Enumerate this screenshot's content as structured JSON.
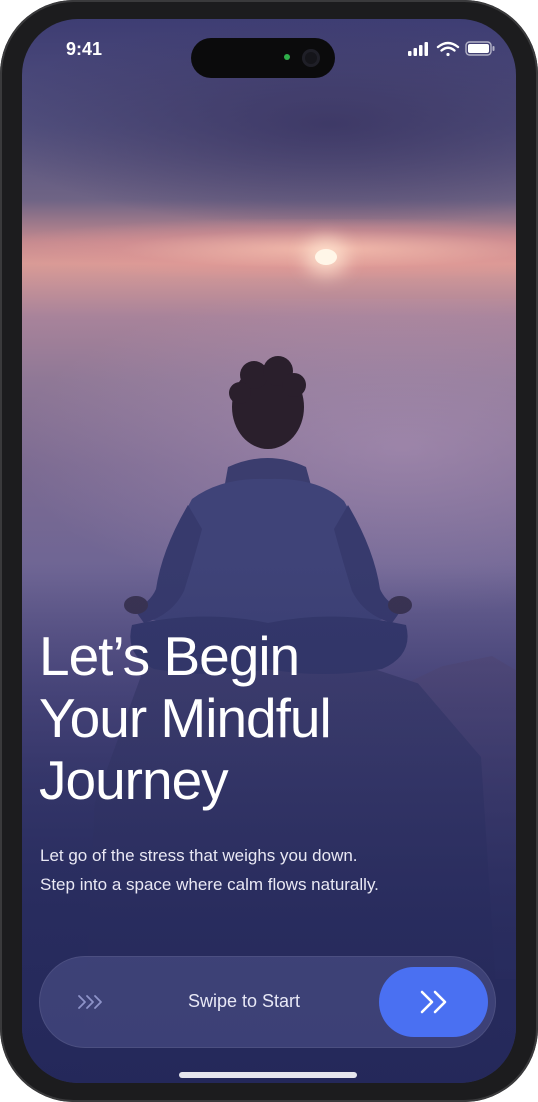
{
  "status_bar": {
    "time": "9:41"
  },
  "hero": {
    "headline_lines": [
      "Let’s Begin",
      "Your Mindful",
      "Journey"
    ],
    "subtitle_lines": [
      "Let go of the stress that weighs you down.",
      "Step into a space where calm flows naturally."
    ]
  },
  "swipe_control": {
    "label": "Swipe to Start"
  },
  "colors": {
    "accent": "#4a70f2",
    "background_top": "#3e3d73",
    "background_bottom": "#2c2f62",
    "text": "#ffffff"
  },
  "icons": {
    "status": [
      "signal-icon",
      "wifi-icon",
      "battery-icon"
    ],
    "swipe_hint": "triple-chevron-right-icon",
    "swipe_knob": "double-chevron-right-icon"
  }
}
